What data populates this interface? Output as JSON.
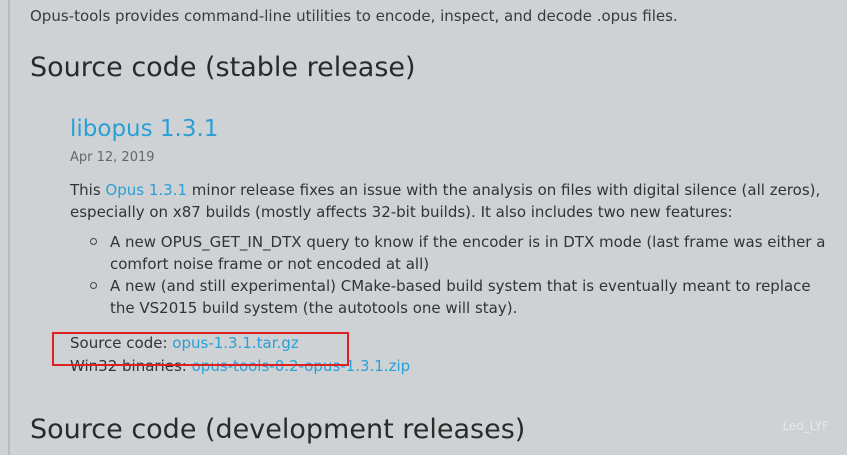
{
  "intro_text": "Opus-tools provides command-line utilities to encode, inspect, and decode .opus files.",
  "stable_heading": "Source code (stable release)",
  "release": {
    "title": "libopus 1.3.1",
    "date": "Apr 12, 2019",
    "desc_prefix": "This ",
    "desc_link": "Opus 1.3.1",
    "desc_suffix": " minor release fixes an issue with the analysis on files with digital silence (all zeros), especially on x87 builds (mostly affects 32-bit builds). It also includes two new features:",
    "features": [
      "A new OPUS_GET_IN_DTX query to know if the encoder is in DTX mode (last frame was either a comfort noise frame or not encoded at all)",
      "A new (and still experimental) CMake-based build system that is eventually meant to replace the VS2015 build system (the autotools one will stay)."
    ],
    "source_label": "Source code: ",
    "source_link": "opus-1.3.1.tar.gz",
    "win32_label": "Win32 binaries: ",
    "win32_link": "opus-tools-0.2-opus-1.3.1.zip"
  },
  "dev_heading": "Source code (development releases)",
  "watermark": "Leo_LYF",
  "colors": {
    "link": "#2a9fd6",
    "background": "#cfd2d5",
    "highlight_box": "#e02020"
  }
}
